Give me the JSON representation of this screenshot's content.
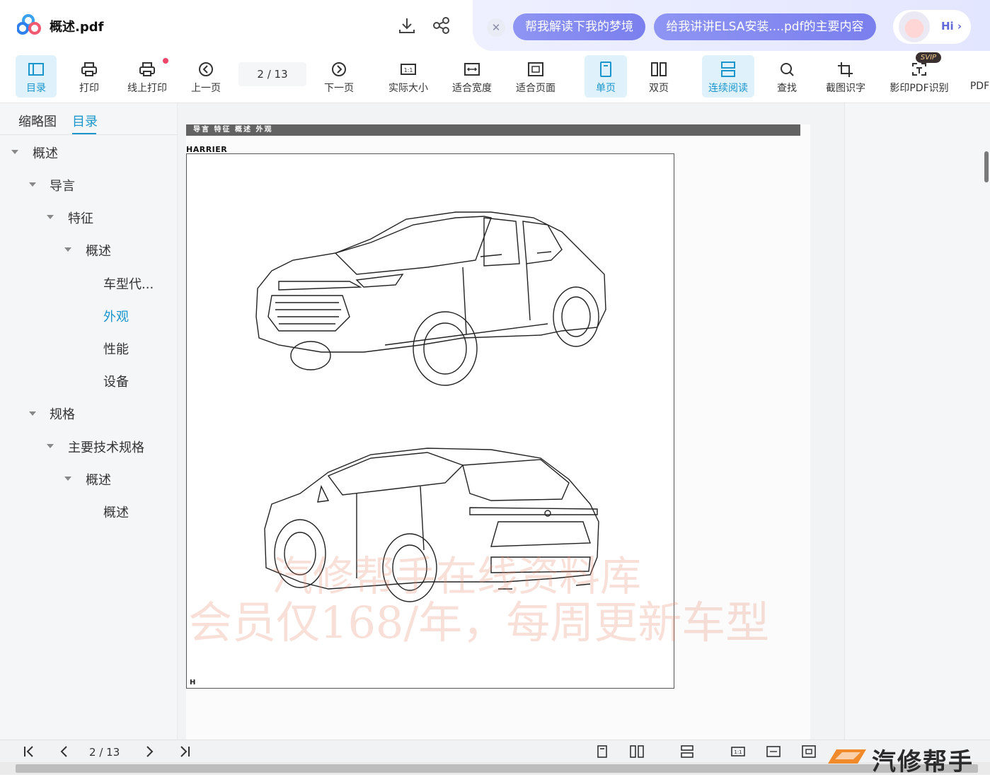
{
  "app": {
    "filename": "概述.pdf"
  },
  "ai": {
    "chip1": "帮我解读下我的梦境",
    "chip2": "给我讲讲ELSA安装....pdf的主要内容",
    "hi": "Hi ›"
  },
  "toolbar": {
    "items": [
      {
        "label": "目录",
        "icon": "sidebar-icon"
      },
      {
        "label": "打印",
        "icon": "printer-icon"
      },
      {
        "label": "线上打印",
        "icon": "online-print-icon"
      },
      {
        "label": "上一页",
        "icon": "prev-page-icon"
      },
      {
        "label": "下一页",
        "icon": "next-page-icon"
      },
      {
        "label": "实际大小",
        "icon": "actual-size-icon"
      },
      {
        "label": "适合宽度",
        "icon": "fit-width-icon"
      },
      {
        "label": "适合页面",
        "icon": "fit-page-icon"
      },
      {
        "label": "单页",
        "icon": "single-page-icon"
      },
      {
        "label": "双页",
        "icon": "double-page-icon"
      },
      {
        "label": "连续阅读",
        "icon": "continuous-icon"
      },
      {
        "label": "查找",
        "icon": "search-icon"
      },
      {
        "label": "截图识字",
        "icon": "crop-ocr-icon"
      },
      {
        "label": "影印PDF识别",
        "icon": "scan-ocr-icon"
      },
      {
        "label": "PDF",
        "icon": "pdf-icon"
      }
    ],
    "page_current": "2",
    "page_total": "/ 13",
    "svip": "SVIP"
  },
  "sidebar": {
    "tab_thumbnails": "缩略图",
    "tab_toc": "目录",
    "toc": [
      {
        "label": "概述"
      },
      {
        "label": "导言"
      },
      {
        "label": "特征"
      },
      {
        "label": "概述"
      },
      {
        "label": "车型代..."
      },
      {
        "label": "外观"
      },
      {
        "label": "性能"
      },
      {
        "label": "设备"
      },
      {
        "label": "规格"
      },
      {
        "label": "主要技术规格"
      },
      {
        "label": "概述"
      },
      {
        "label": "概述"
      }
    ]
  },
  "document": {
    "header": "导言  特征  概述  外观",
    "model": "HARRIER",
    "corner": "H",
    "watermark1": "汽修帮手在线资料库",
    "watermark2": "会员仅168/年，每周更新车型"
  },
  "bottombar": {
    "page_current": "2",
    "page_total": "/ 13"
  },
  "brand": {
    "text": "汽修帮手"
  }
}
